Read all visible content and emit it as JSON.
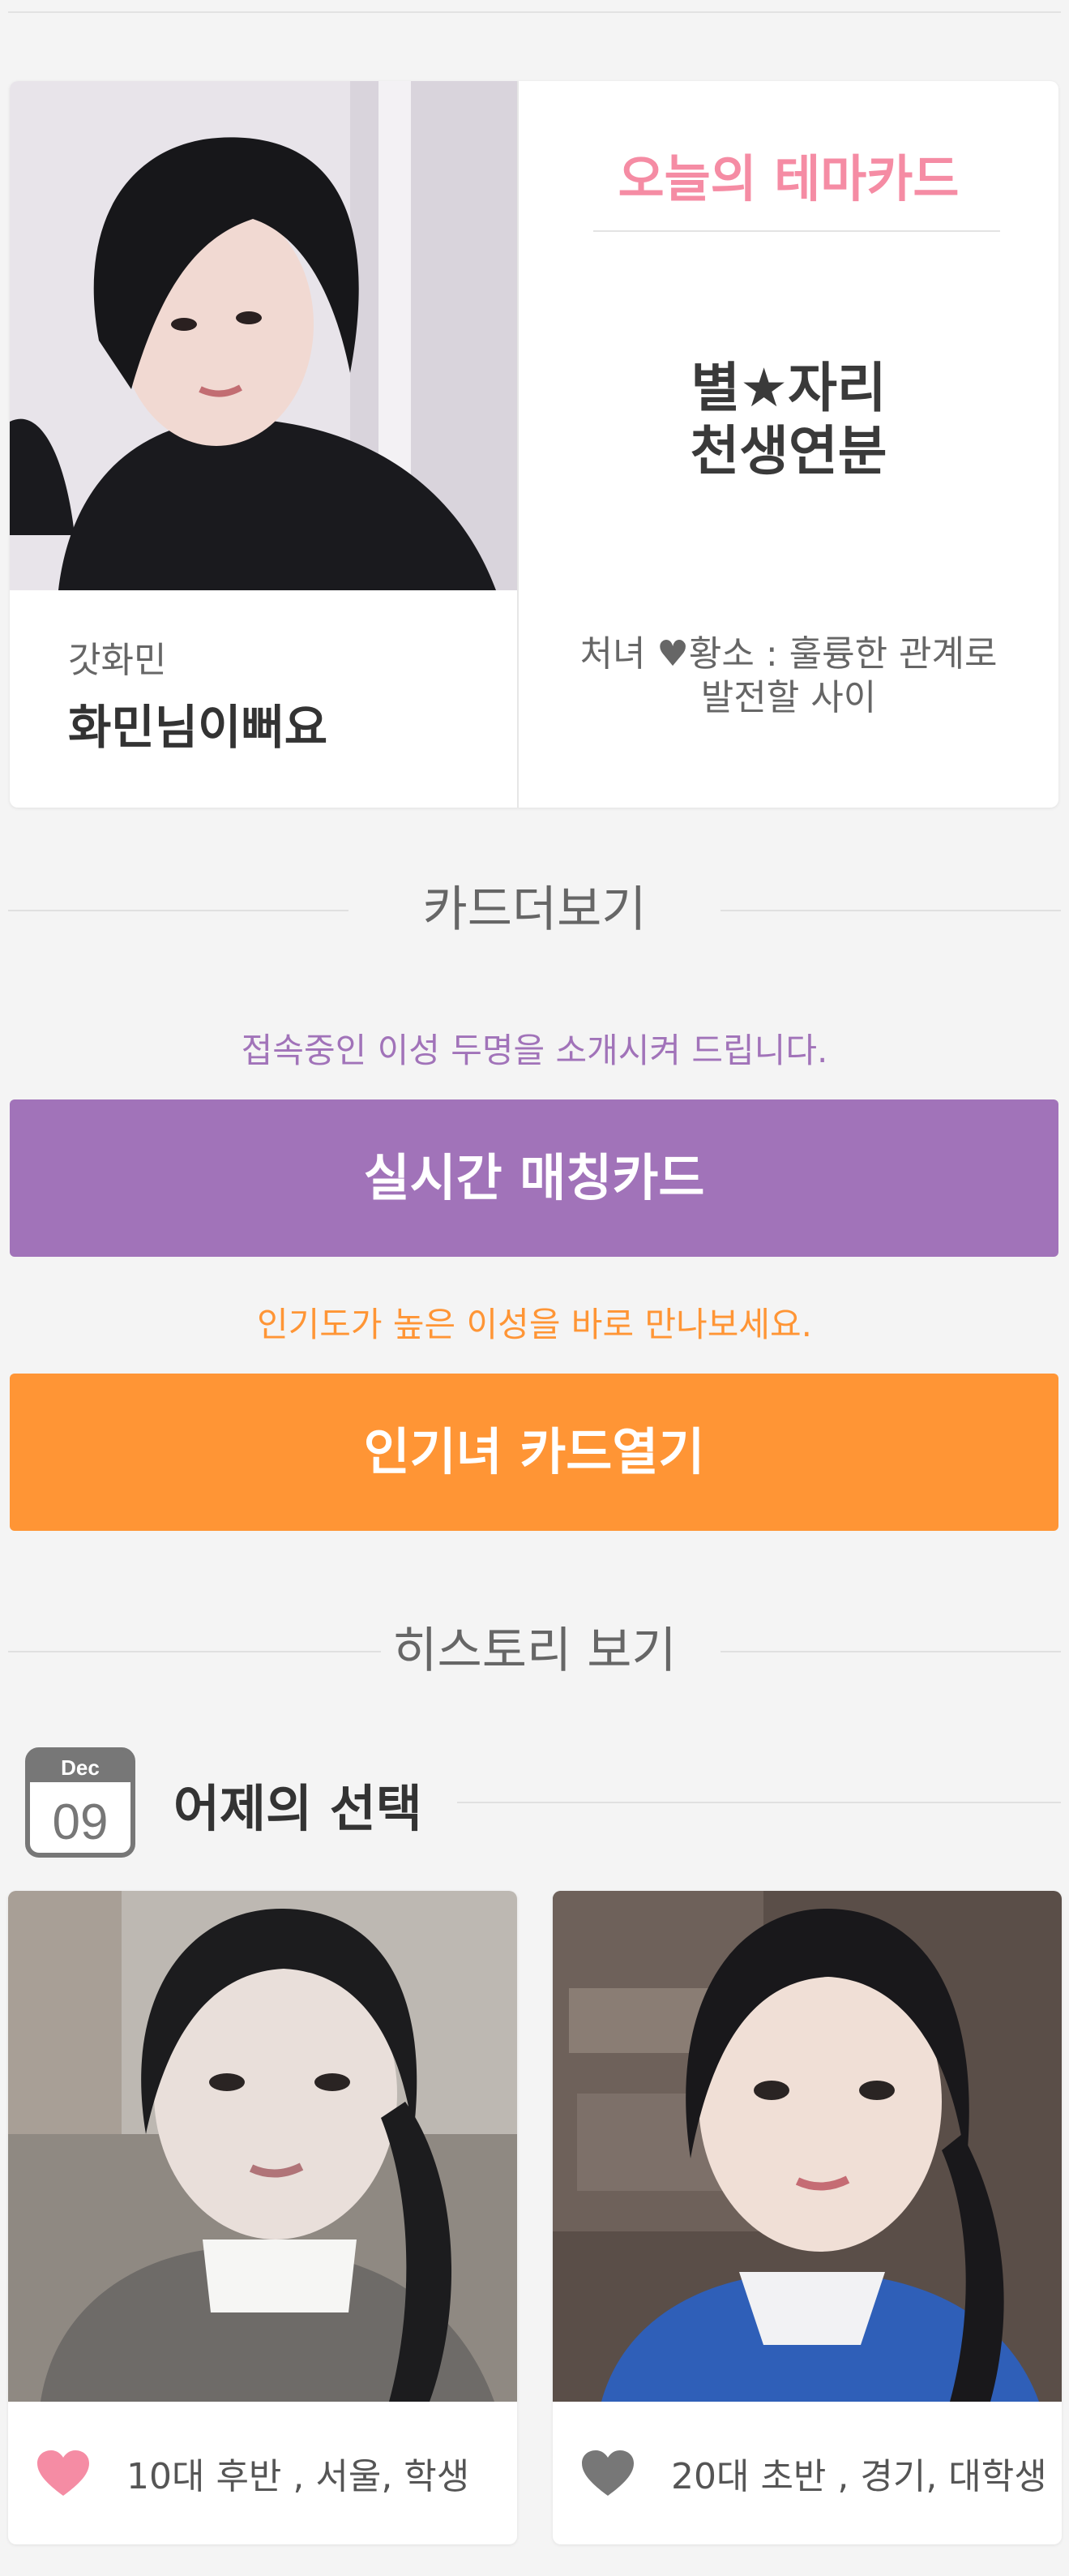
{
  "theme_card": {
    "user_nickname": "갓화민",
    "user_message": "화민님이뻐요",
    "title": "오늘의 테마카드",
    "theme_name": "별★자리\n천생연분",
    "description": "처녀 ♥황소 : 훌륭한 관계로\n발전할 사이"
  },
  "card_more": {
    "header": "카드더보기",
    "realtime_caption": "접속중인 이성 두명을 소개시켜 드립니다.",
    "realtime_button": "실시간 매칭카드",
    "popular_caption": "인기도가 높은 이성을 바로 만나보세요.",
    "popular_button": "인기녀 카드열기"
  },
  "history": {
    "header": "히스토리 보기",
    "calendar_month": "Dec",
    "calendar_day": "09",
    "title": "어제의 선택",
    "cards": [
      {
        "info": "10대 후반 , 서울, 학생",
        "liked": true
      },
      {
        "info": "20대 초반 , 경기, 대학생",
        "liked": false
      }
    ]
  },
  "colors": {
    "theme_title": "#f58ca4",
    "realtime": "#a173b9",
    "popular": "#ff9535",
    "heart_liked": "#f58ca4",
    "heart_unliked": "#777777"
  }
}
